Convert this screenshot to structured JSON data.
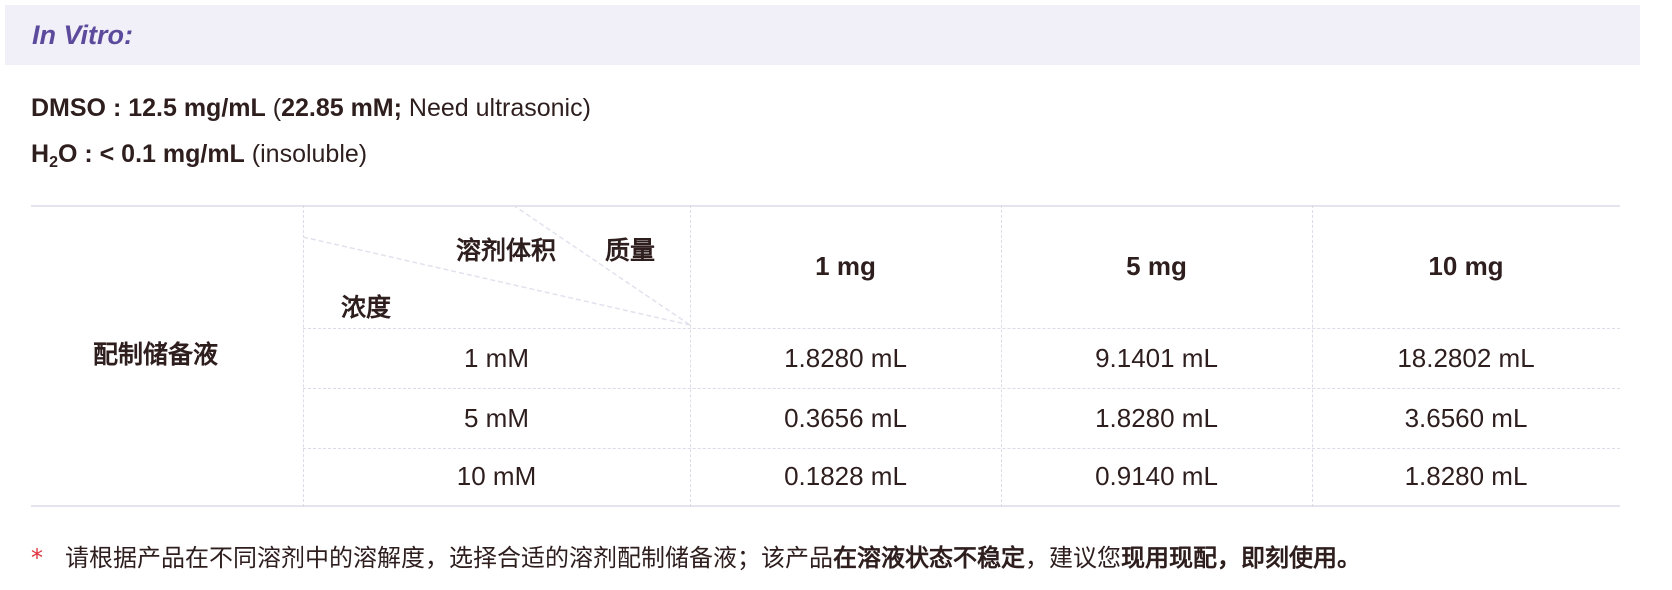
{
  "section": {
    "title": "In Vitro:"
  },
  "solubility": {
    "line1": {
      "solvent": "DMSO",
      "sep": " : ",
      "value": "12.5 mg/mL",
      "open": " (",
      "molar": "22.85 mM;",
      "note": " Need ultrasonic)"
    },
    "line2": {
      "solvent_h": "H",
      "solvent_sub": "2",
      "solvent_o": "O",
      "sep": " : ",
      "value": "< 0.1 mg/mL",
      "note": " (insoluble)"
    }
  },
  "table": {
    "row_group_label": "配制储备液",
    "header_diag_top_left": "溶剂体积",
    "header_diag_top_right": "质量",
    "header_diag_bottom": "浓度",
    "mass_columns": [
      "1 mg",
      "5 mg",
      "10 mg"
    ],
    "rows": [
      {
        "concentration": "1 mM",
        "values": [
          "1.8280 mL",
          "9.1401 mL",
          "18.2802 mL"
        ]
      },
      {
        "concentration": "5 mM",
        "values": [
          "0.3656 mL",
          "1.8280 mL",
          "3.6560 mL"
        ]
      },
      {
        "concentration": "10 mM",
        "values": [
          "0.1828 mL",
          "0.9140 mL",
          "1.8280 mL"
        ]
      }
    ]
  },
  "footnote": {
    "star": "*",
    "part1": "请根据产品在不同溶剂中的溶解度，选择合适的溶剂配制储备液；该产品",
    "bold1": "在溶液状态不稳定",
    "part2": "，建议您",
    "bold2": "现用现配，即刻使用。"
  },
  "colors": {
    "accent": "#5c4a9c",
    "header_bg": "#f1f0f8",
    "star": "#e0303c",
    "text": "#2e1e1e"
  }
}
